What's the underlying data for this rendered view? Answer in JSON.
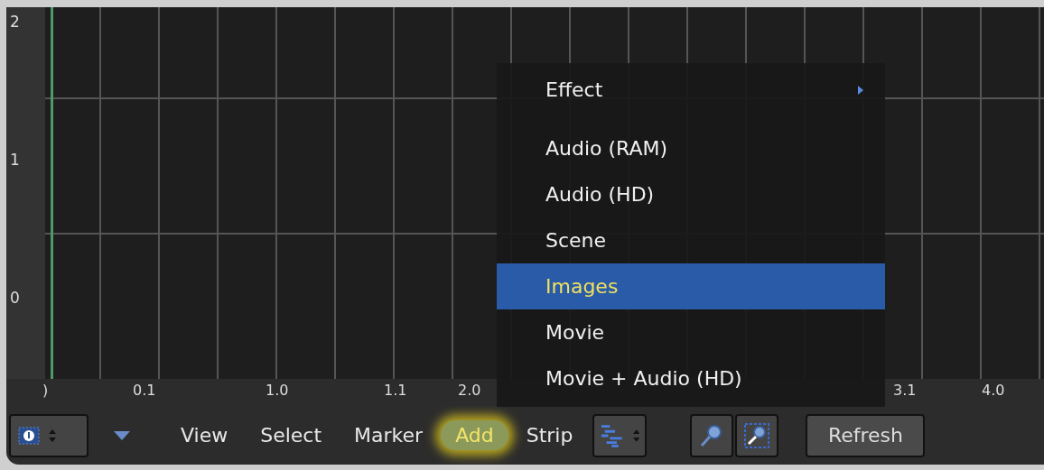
{
  "channels": [
    "2",
    "1",
    "0"
  ],
  "ruler": [
    ")",
    "0.1",
    "1.0",
    "1.1",
    "2.0",
    "3.1",
    "4.0"
  ],
  "header": {
    "menus": [
      {
        "label": "View",
        "highlighted": false
      },
      {
        "label": "Select",
        "highlighted": false
      },
      {
        "label": "Marker",
        "highlighted": false
      },
      {
        "label": "Add",
        "highlighted": true
      },
      {
        "label": "Strip",
        "highlighted": false
      }
    ],
    "refresh": "Refresh"
  },
  "add_menu": {
    "items": [
      {
        "label": "Effect",
        "kind": "submenu",
        "selected": false
      },
      {
        "label": "Audio (RAM)",
        "kind": "item",
        "selected": false
      },
      {
        "label": "Audio (HD)",
        "kind": "item",
        "selected": false
      },
      {
        "label": "Scene",
        "kind": "item",
        "selected": false
      },
      {
        "label": "Images",
        "kind": "item",
        "selected": true
      },
      {
        "label": "Movie",
        "kind": "item",
        "selected": false
      },
      {
        "label": "Movie + Audio (HD)",
        "kind": "item",
        "selected": false
      }
    ]
  }
}
